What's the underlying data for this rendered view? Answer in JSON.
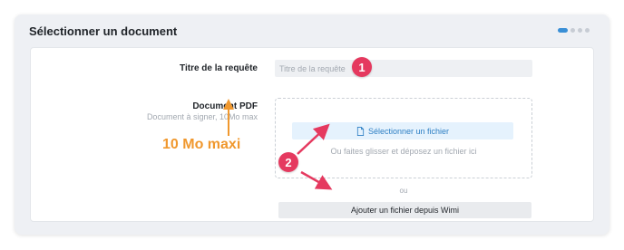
{
  "card": {
    "title": "Sélectionner un document",
    "steps": {
      "total": 4,
      "active": 1
    }
  },
  "form": {
    "title_label": "Titre de la requête",
    "title_placeholder": "Titre de la requête",
    "title_value": "",
    "document_label": "Document PDF",
    "document_hint": "Document à signer, 10Mo max",
    "select_file_button": "Sélectionner un fichier",
    "drop_hint": "Ou faites glisser et déposez un fichier ici",
    "or_separator": "ou",
    "wimi_button": "Ajouter un fichier depuis Wimi"
  },
  "annotations": {
    "orange_note": "10 Mo maxi",
    "badge_1": "1",
    "badge_2": "2",
    "colors": {
      "badge": "#e5395f",
      "orange": "#f0982e",
      "accent": "#3a8fd6"
    }
  },
  "icons": {
    "file": "file-icon"
  }
}
